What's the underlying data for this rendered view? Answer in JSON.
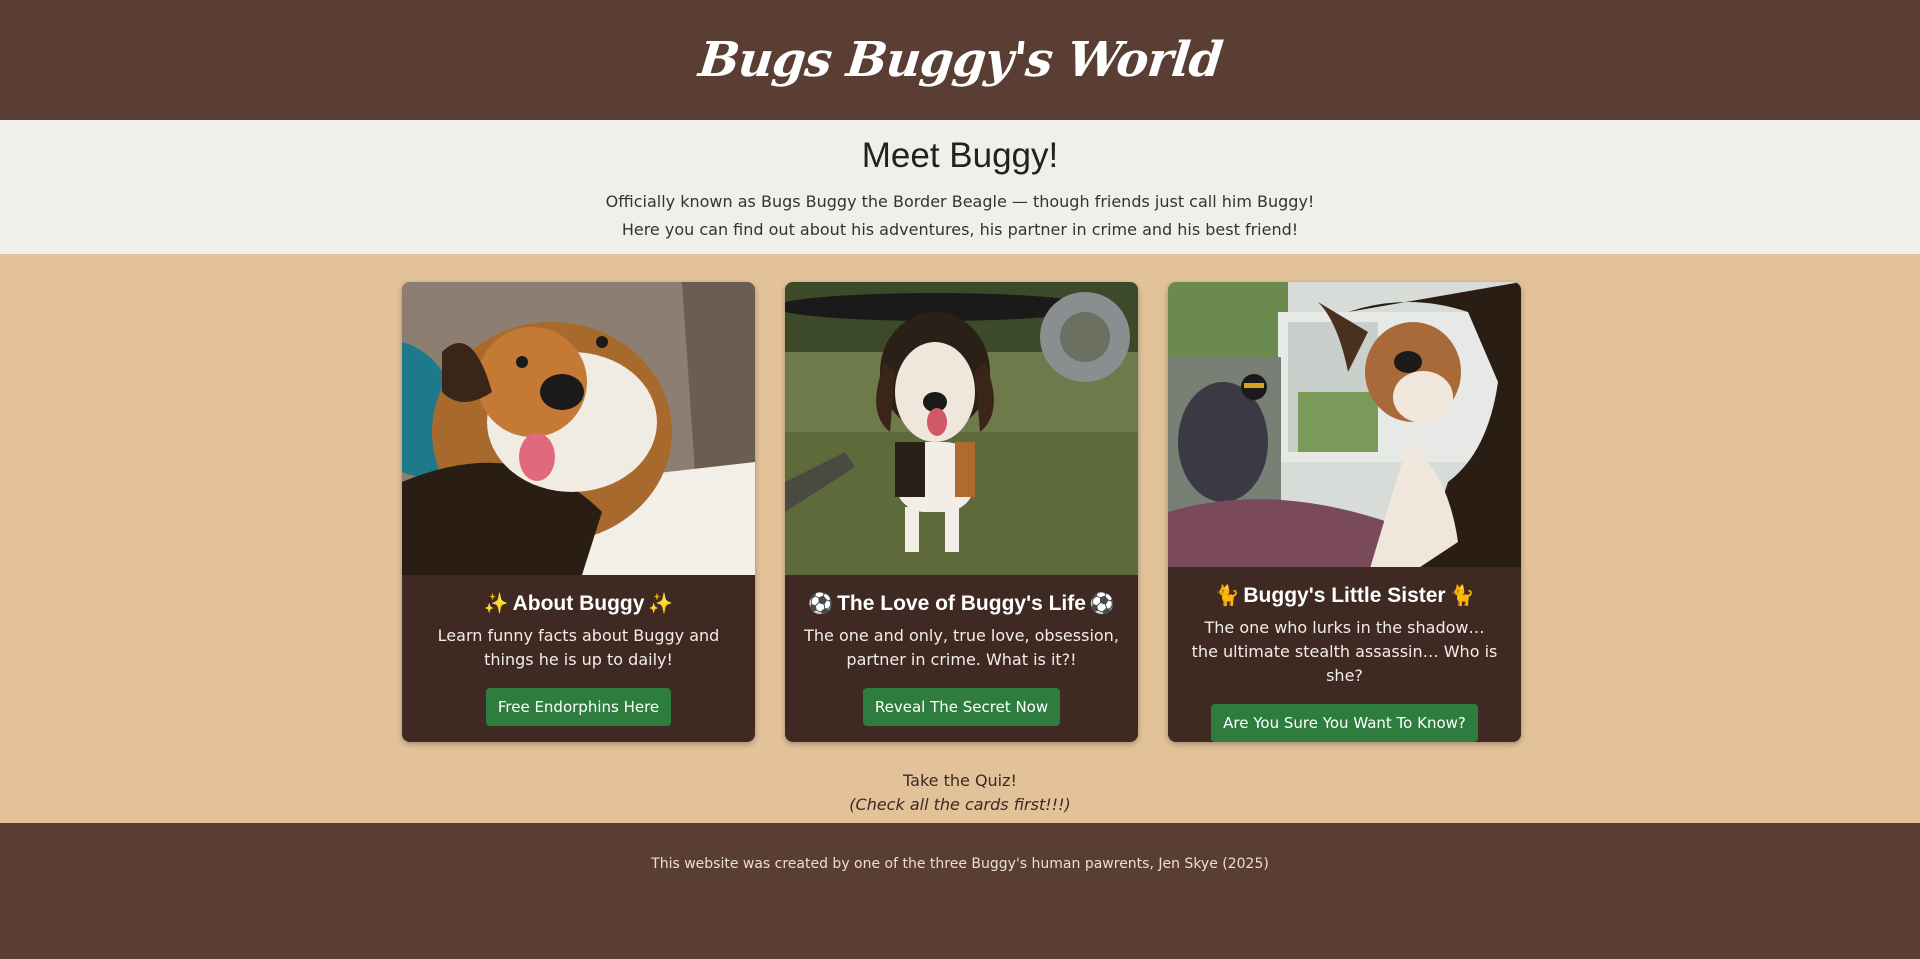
{
  "header": {
    "title": "Bugs Buggy's World"
  },
  "intro": {
    "heading": "Meet Buggy!",
    "line1": "Officially known as Bugs Buggy the Border Beagle — though friends just call him Buggy!",
    "line2": "Here you can find out about his adventures, his partner in crime and his best friend!"
  },
  "cards": [
    {
      "emoji": "✨",
      "title": "About Buggy",
      "text": "Learn funny facts about Buggy and things he is up to daily!",
      "button": "Free Endorphins Here"
    },
    {
      "emoji": "⚽",
      "title": "The Love of Buggy's Life",
      "text": "The one and only, true love, obsession, partner in crime. What is it?!",
      "button": "Reveal The Secret Now"
    },
    {
      "emoji": "🐈",
      "title": "Buggy's Little Sister",
      "text": "The one who lurks in the shadow…\nthe ultimate stealth assassin… Who is she?",
      "button": "Are You Sure You Want To Know?"
    }
  ],
  "quiz": {
    "link": "Take the Quiz!",
    "hint": "(Check all the cards first!!!)"
  },
  "footer": {
    "text": "This website was created by one of the three Buggy's human pawrents, Jen Skye (2025)"
  },
  "colors": {
    "header_bg": "#5a3e34",
    "intro_bg": "#f1efea",
    "main_bg": "#e3c29a",
    "card_bg": "#3e2a22",
    "button_bg": "#2e7d3f"
  }
}
